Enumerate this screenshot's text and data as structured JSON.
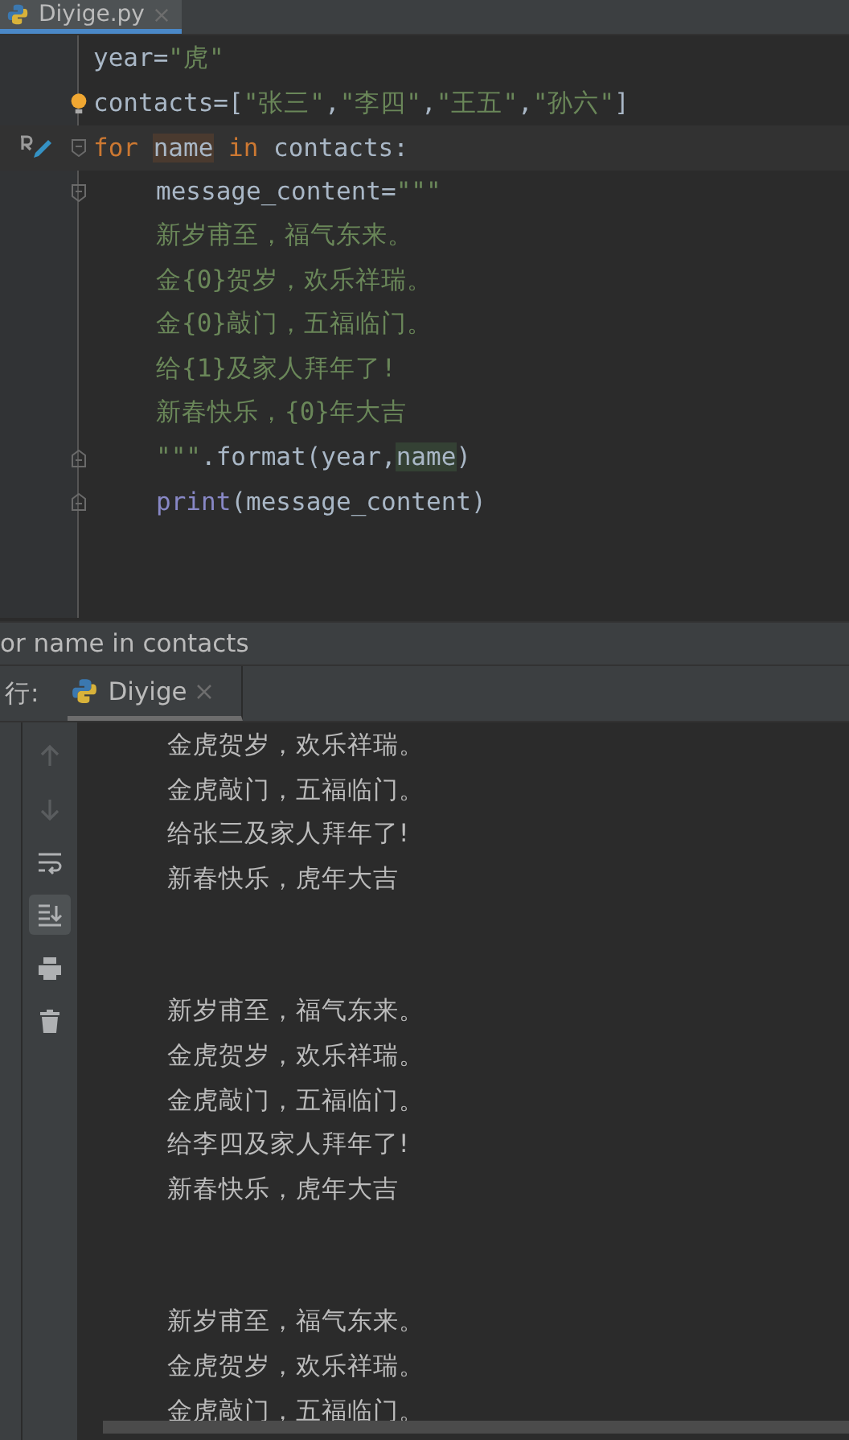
{
  "file_tab": {
    "title": "Diyige.py",
    "selected": true
  },
  "code_lines": [
    {
      "current": false,
      "fold_open": false,
      "fold_close": false,
      "gutter_mark": false,
      "intention": false,
      "tokens": [
        {
          "text": "year",
          "kind": "ident",
          "highlighted": false
        },
        {
          "text": "=",
          "kind": "plain",
          "highlighted": false
        },
        {
          "text": "\"虎\"",
          "kind": "string",
          "highlighted": false
        }
      ]
    },
    {
      "current": false,
      "fold_open": false,
      "fold_close": false,
      "gutter_mark": false,
      "intention": true,
      "tokens": [
        {
          "text": "contacts",
          "kind": "ident",
          "highlighted": false
        },
        {
          "text": "=[",
          "kind": "plain",
          "highlighted": false
        },
        {
          "text": "\"张三\"",
          "kind": "string",
          "highlighted": false
        },
        {
          "text": ",",
          "kind": "plain",
          "highlighted": false
        },
        {
          "text": "\"李四\"",
          "kind": "string",
          "highlighted": false
        },
        {
          "text": ",",
          "kind": "plain",
          "highlighted": false
        },
        {
          "text": "\"王五\"",
          "kind": "string",
          "highlighted": false
        },
        {
          "text": ",",
          "kind": "plain",
          "highlighted": false
        },
        {
          "text": "\"孙六\"",
          "kind": "string",
          "highlighted": false
        },
        {
          "text": "]",
          "kind": "plain",
          "highlighted": false
        }
      ]
    },
    {
      "current": true,
      "fold_open": true,
      "fold_close": false,
      "gutter_mark": true,
      "intention": false,
      "tokens": [
        {
          "text": "for ",
          "kind": "keyword",
          "highlighted": false
        },
        {
          "text": "name",
          "kind": "ident",
          "highlighted": true
        },
        {
          "text": " in",
          "kind": "keyword",
          "highlighted": false
        },
        {
          "text": " contacts:",
          "kind": "plain",
          "highlighted": false
        }
      ],
      "children": [
        {
          "current": false,
          "fold_open": true,
          "fold_close": false,
          "gutter_mark": false,
          "intention": false,
          "tokens": [
            {
              "text": "message_content=",
              "kind": "plain",
              "highlighted": false
            },
            {
              "text": "\"\"\"",
              "kind": "string",
              "highlighted": false
            }
          ]
        },
        {
          "current": false,
          "fold_open": false,
          "fold_close": false,
          "gutter_mark": false,
          "intention": false,
          "tokens": [
            {
              "text": "新岁甫至，福气东来。",
              "kind": "string",
              "highlighted": false
            }
          ]
        },
        {
          "current": false,
          "fold_open": false,
          "fold_close": false,
          "gutter_mark": false,
          "intention": false,
          "tokens": [
            {
              "text": "金{0}贺岁，欢乐祥瑞。",
              "kind": "string",
              "highlighted": false
            }
          ]
        },
        {
          "current": false,
          "fold_open": false,
          "fold_close": false,
          "gutter_mark": false,
          "intention": false,
          "tokens": [
            {
              "text": "金{0}敲门，五福临门。",
              "kind": "string",
              "highlighted": false
            }
          ]
        },
        {
          "current": false,
          "fold_open": false,
          "fold_close": false,
          "gutter_mark": false,
          "intention": false,
          "tokens": [
            {
              "text": "给{1}及家人拜年了!",
              "kind": "string",
              "highlighted": false
            }
          ]
        },
        {
          "current": false,
          "fold_open": false,
          "fold_close": false,
          "gutter_mark": false,
          "intention": false,
          "tokens": [
            {
              "text": "新春快乐，{0}年大吉",
              "kind": "string",
              "highlighted": false
            }
          ]
        },
        {
          "current": false,
          "fold_open": false,
          "fold_close": true,
          "gutter_mark": false,
          "intention": false,
          "tokens": [
            {
              "text": "\"\"\"",
              "kind": "string",
              "highlighted": false
            },
            {
              "text": ".format(year,",
              "kind": "plain",
              "highlighted": false
            },
            {
              "text": "name",
              "kind": "plain",
              "highlighted": true
            },
            {
              "text": ")",
              "kind": "plain",
              "highlighted": false
            }
          ]
        },
        {
          "current": false,
          "fold_open": false,
          "fold_close": true,
          "gutter_mark": false,
          "intention": false,
          "tokens": [
            {
              "text": "print",
              "kind": "builtin",
              "highlighted": false
            },
            {
              "text": "(message_content)",
              "kind": "plain",
              "highlighted": false
            }
          ]
        }
      ]
    }
  ],
  "breadcrumb": "or name in contacts",
  "run_panel": {
    "label": "行:",
    "tabs": [
      {
        "title": "Diyige",
        "selected": true
      }
    ]
  },
  "console_toolbar": [
    {
      "kind": "up",
      "selected": false,
      "disabled": true
    },
    {
      "kind": "down",
      "selected": false,
      "disabled": true
    },
    {
      "kind": "wrap",
      "selected": false,
      "disabled": false
    },
    {
      "kind": "scroll-end",
      "selected": true,
      "disabled": false
    },
    {
      "kind": "print",
      "selected": false,
      "disabled": false
    },
    {
      "kind": "trash",
      "selected": false,
      "disabled": false
    }
  ],
  "console_blocks": [
    [
      "金虎贺岁，欢乐祥瑞。",
      "金虎敲门，五福临门。",
      "给张三及家人拜年了!",
      "新春快乐，虎年大吉"
    ],
    [
      "新岁甫至，福气东来。",
      "金虎贺岁，欢乐祥瑞。",
      "金虎敲门，五福临门。",
      "给李四及家人拜年了!",
      "新春快乐，虎年大吉"
    ],
    [
      "新岁甫至，福气东来。",
      "金虎贺岁，欢乐祥瑞。",
      "金虎敲门，五福临门。"
    ]
  ]
}
